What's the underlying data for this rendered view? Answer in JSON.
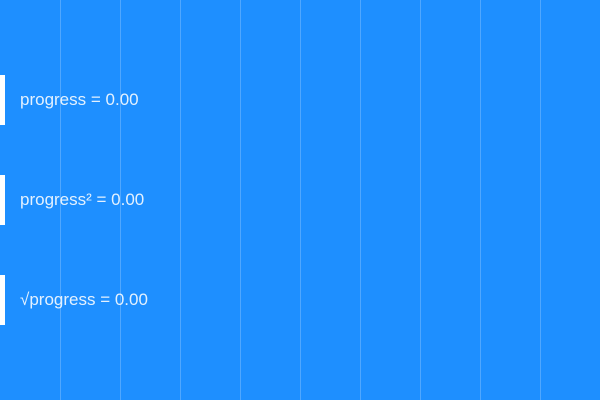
{
  "background_color": "#1e8fff",
  "rows": [
    {
      "label": "progress = 0.00",
      "value": 0.0
    },
    {
      "label": "progress² = 0.00",
      "value": 0.0
    },
    {
      "label": "√progress = 0.00",
      "value": 0.0
    }
  ]
}
